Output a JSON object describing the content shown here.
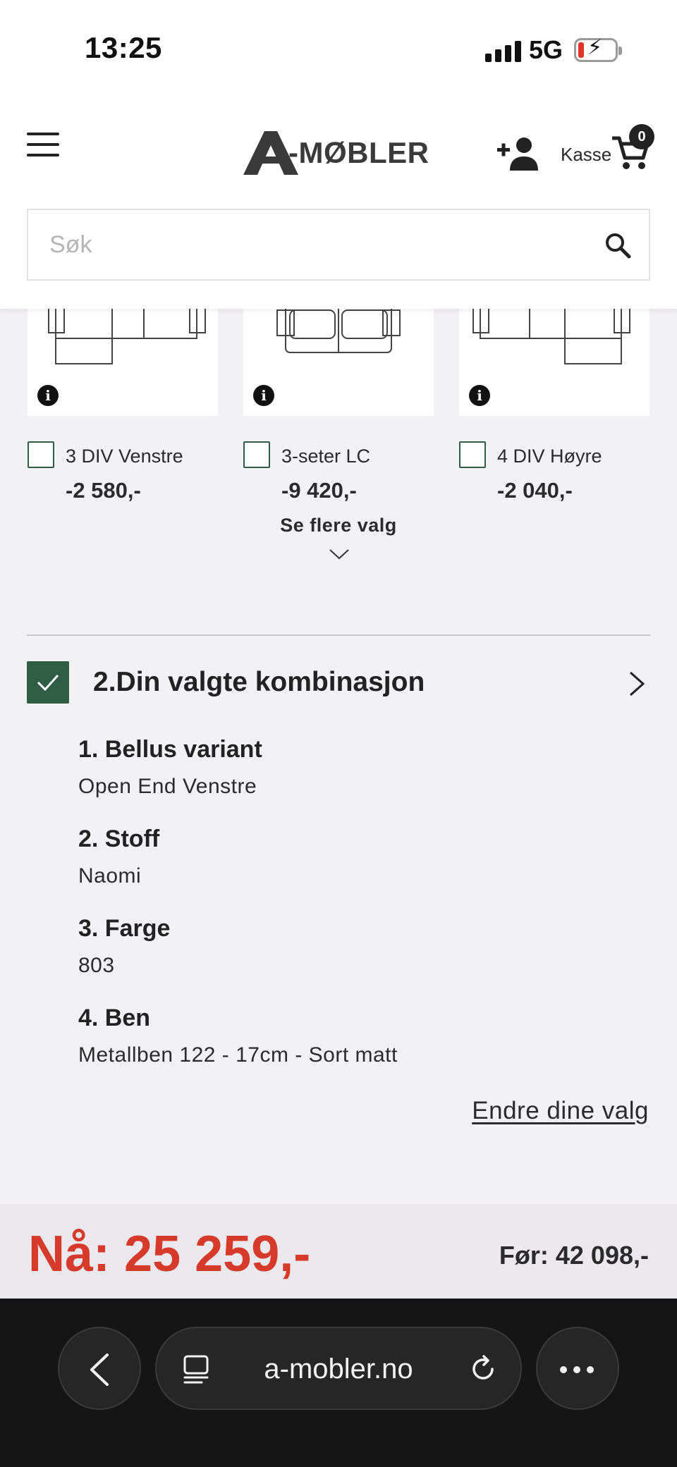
{
  "status_bar": {
    "time": "13:25",
    "network": "5G"
  },
  "header": {
    "logo_text": "-MØBLER",
    "checkout_label": "Kasse",
    "cart_count": "0",
    "search_placeholder": "Søk"
  },
  "options": [
    {
      "label": "3 DIV Venstre",
      "price": "-2 580,-"
    },
    {
      "label": "3-seter LC",
      "price": "-9 420,-"
    },
    {
      "label": "4 DIV Høyre",
      "price": "-2 040,-"
    }
  ],
  "more_options_label": "Se flere valg",
  "combination": {
    "title": "2.Din valgte kombinasjon",
    "items": [
      {
        "heading": "1. Bellus variant",
        "value": "Open End Venstre"
      },
      {
        "heading": "2. Stoff",
        "value": "Naomi"
      },
      {
        "heading": "3. Farge",
        "value": "803"
      },
      {
        "heading": "4. Ben",
        "value": "Metallben 122 - 17cm - Sort matt"
      }
    ],
    "edit_label": "Endre dine valg"
  },
  "pricing": {
    "now": "Nå: 25 259,-",
    "before": "Før: 42 098,-"
  },
  "browser": {
    "url": "a-mobler.no"
  },
  "colors": {
    "accent_green": "#2f5e45",
    "price_red": "#d63a2a",
    "browser_bg": "#151515"
  }
}
